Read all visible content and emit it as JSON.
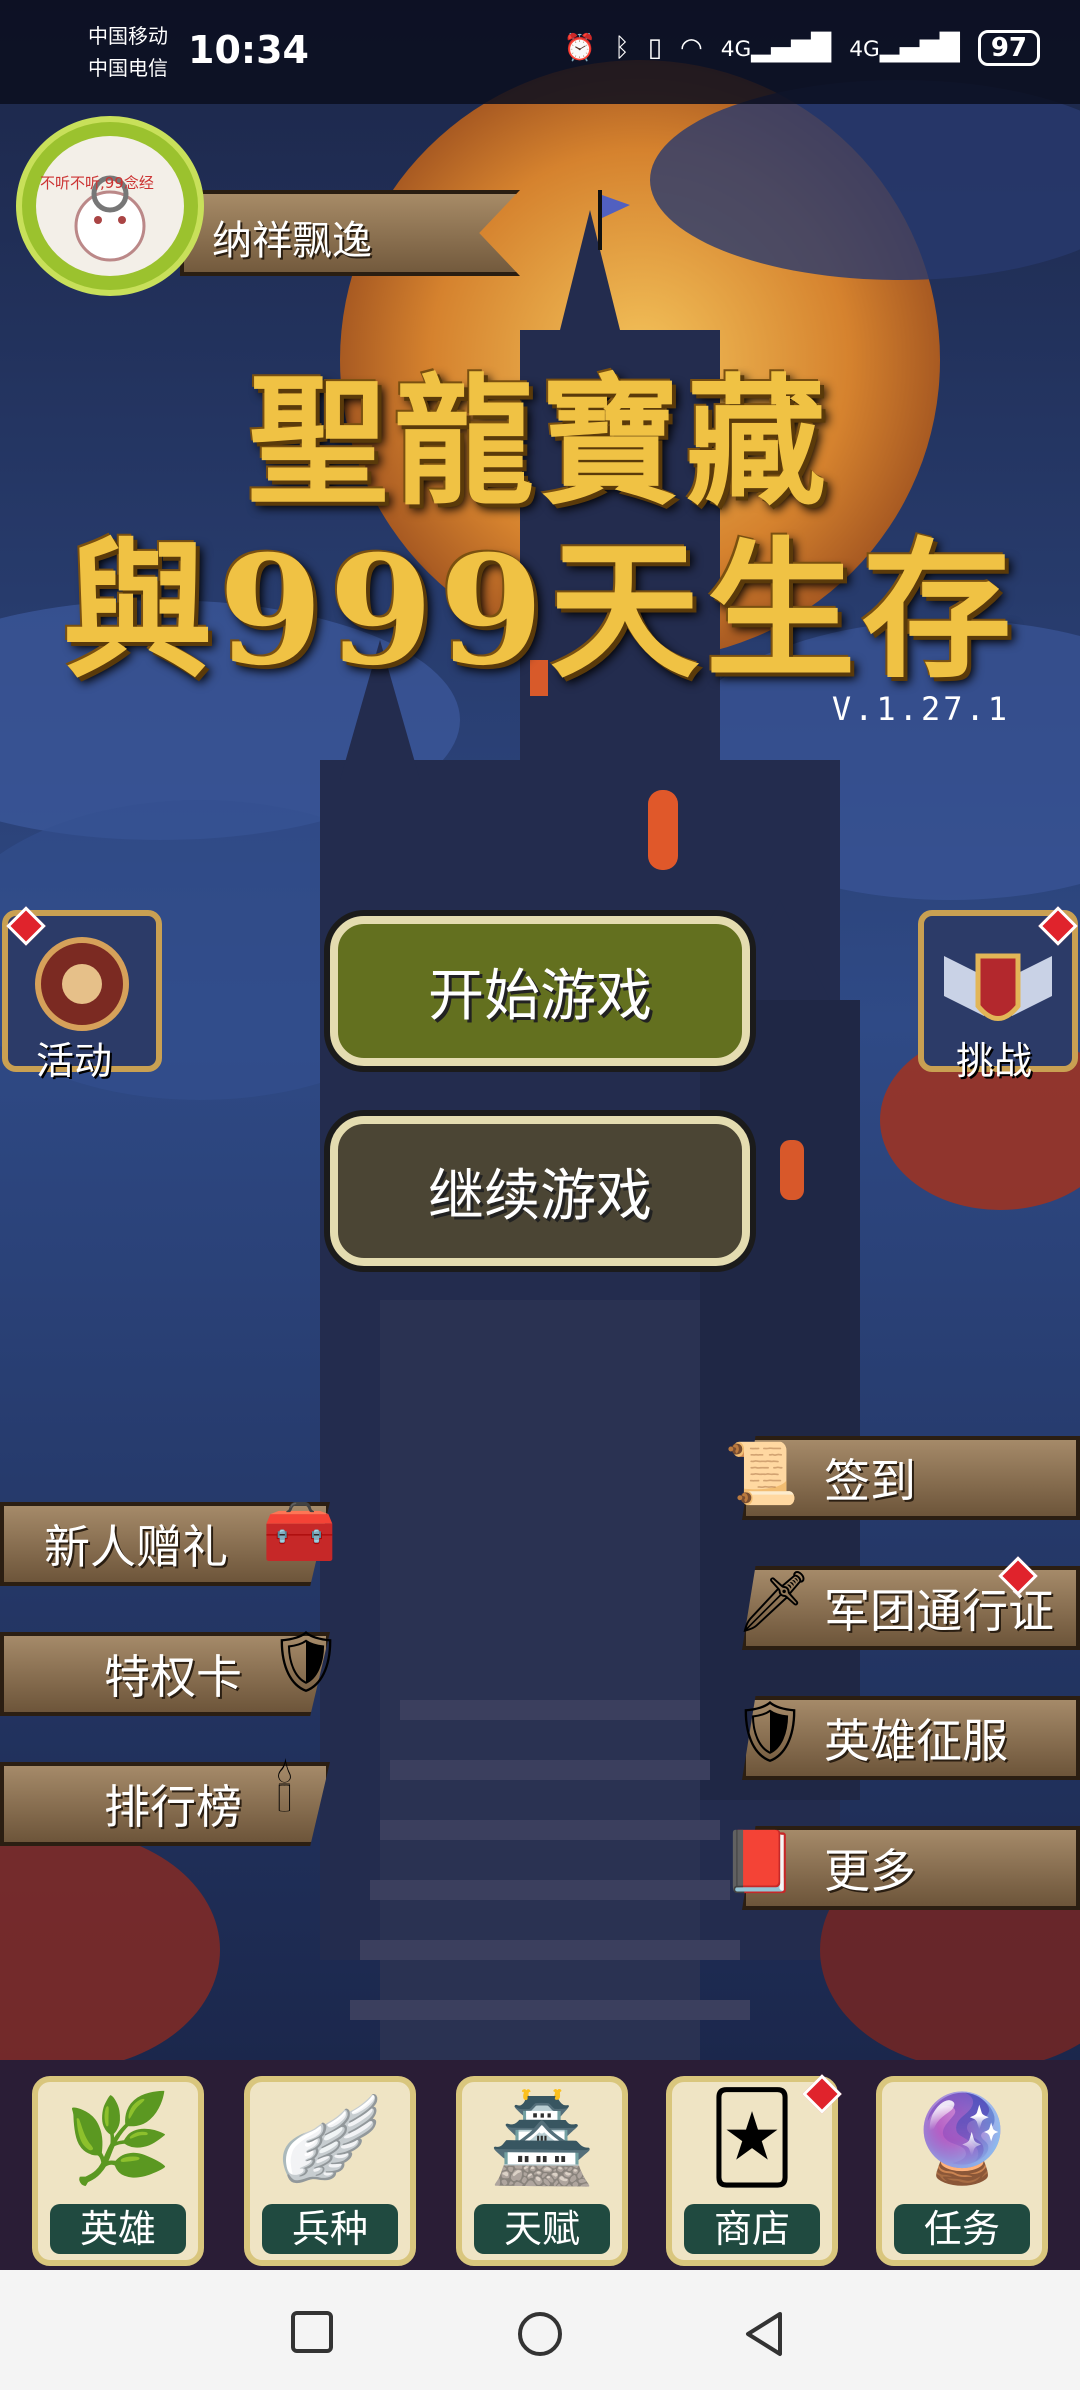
{
  "status_bar": {
    "carrier1": "中国移动",
    "carrier2": "中国电信",
    "time": "10:34",
    "signal1": "4G",
    "signal2": "4G",
    "battery": "97"
  },
  "player": {
    "name": "纳祥飘逸",
    "avatar_text": "不听不听,99念经"
  },
  "title": {
    "line1": "聖龍寶藏",
    "line2": "與999天生存"
  },
  "version": "V.1.27.1",
  "side": {
    "activity_label": "活动",
    "challenge_label": "挑战"
  },
  "buttons": {
    "start": "开始游戏",
    "continue": "继续游戏"
  },
  "left_menu": [
    {
      "label": "新人赠礼",
      "icon": "treasure-chest-icon"
    },
    {
      "label": "特权卡",
      "icon": "crest-icon"
    },
    {
      "label": "排行榜",
      "icon": "candle-icon"
    }
  ],
  "right_menu": [
    {
      "label": "签到",
      "icon": "scroll-icon"
    },
    {
      "label": "军团通行证",
      "icon": "sword-icon"
    },
    {
      "label": "英雄征服",
      "icon": "shield-icon"
    },
    {
      "label": "更多",
      "icon": "book-icon"
    }
  ],
  "bottom_nav": [
    {
      "label": "英雄",
      "icon": "laurel-icon"
    },
    {
      "label": "兵种",
      "icon": "wings-icon"
    },
    {
      "label": "天赋",
      "icon": "tower-icon"
    },
    {
      "label": "商店",
      "icon": "cards-icon"
    },
    {
      "label": "任务",
      "icon": "orb-icon"
    }
  ],
  "colors": {
    "title_gold": "#f0c244",
    "start_green": "#63701f",
    "plank": "#8c7150",
    "alert_red": "#e0232c"
  }
}
